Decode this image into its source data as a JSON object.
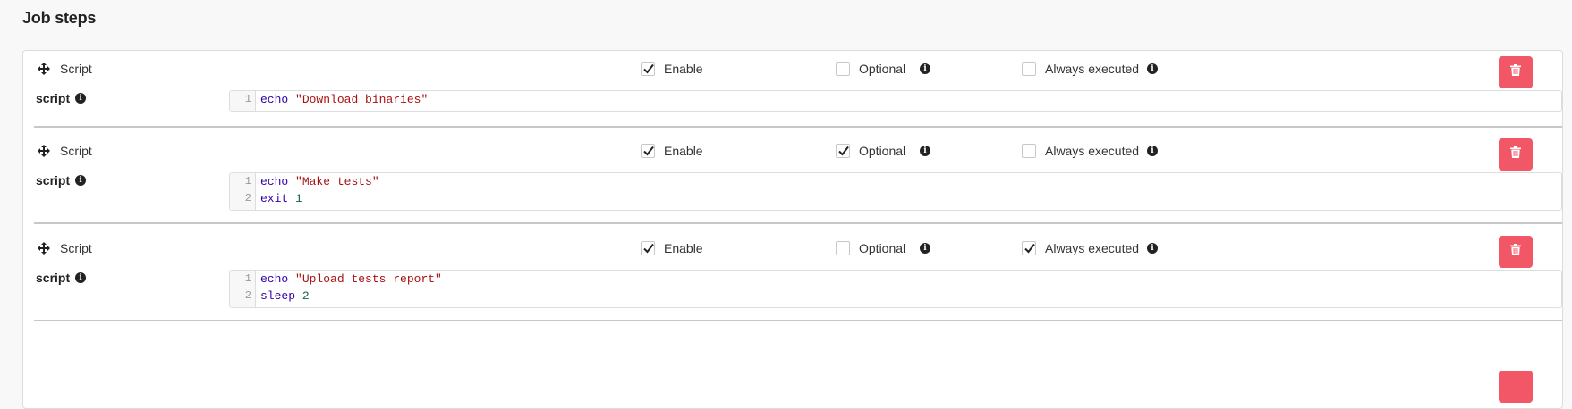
{
  "title": "Job steps",
  "labels": {
    "enable": "Enable",
    "optional": "Optional",
    "always": "Always executed",
    "script": "script"
  },
  "colors": {
    "delete_button": "#f15767",
    "keyword": "#3300aa",
    "string": "#aa1111",
    "number": "#116644"
  },
  "steps": [
    {
      "type": "Script",
      "enable": true,
      "optional": false,
      "always_executed": false,
      "lines": [
        {
          "n": "1",
          "kw": "echo",
          "arg": "\"Download binaries\"",
          "arg_type": "str"
        }
      ]
    },
    {
      "type": "Script",
      "enable": true,
      "optional": true,
      "always_executed": false,
      "lines": [
        {
          "n": "1",
          "kw": "echo",
          "arg": "\"Make tests\"",
          "arg_type": "str"
        },
        {
          "n": "2",
          "kw": "exit",
          "arg": "1",
          "arg_type": "num"
        }
      ]
    },
    {
      "type": "Script",
      "enable": true,
      "optional": false,
      "always_executed": true,
      "lines": [
        {
          "n": "1",
          "kw": "echo",
          "arg": "\"Upload tests report\"",
          "arg_type": "str"
        },
        {
          "n": "2",
          "kw": "sleep",
          "arg": "2",
          "arg_type": "num"
        }
      ]
    }
  ]
}
